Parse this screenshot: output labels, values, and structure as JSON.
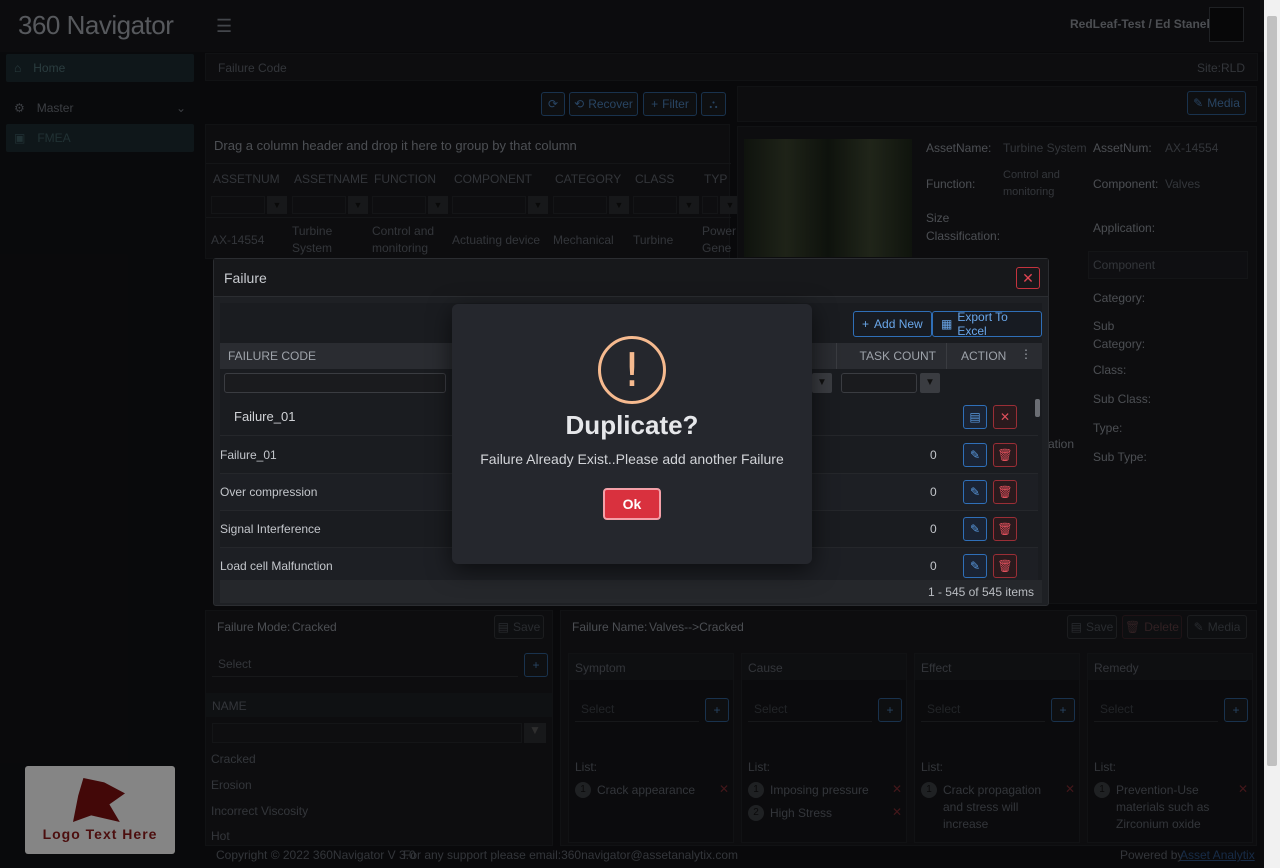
{
  "app": {
    "logo": "360 Navigator",
    "user": "RedLeaf-Test / Ed Stanek"
  },
  "sidebar": {
    "items": [
      {
        "label": "Home",
        "icon": "home-icon"
      },
      {
        "label": "Master",
        "icon": "gear-icon"
      },
      {
        "label": "FMEA",
        "icon": "layers-icon"
      }
    ],
    "logo_text": "Logo Text Here"
  },
  "breadcrumb": {
    "title": "Failure Code",
    "site": "Site:RLD"
  },
  "toolbar": {
    "recover": "Recover",
    "filter": "Filter"
  },
  "grid": {
    "group_hint": "Drag a column header and drop it here to group by that column",
    "columns": [
      "ASSETNUM",
      "ASSETNAME",
      "FUNCTION",
      "COMPONENT",
      "CATEGORY",
      "CLASS",
      "TYP"
    ],
    "row": [
      "AX-14554",
      "Turbine System",
      "Control and monitoring",
      "Actuating device",
      "Mechanical",
      "Turbine",
      "Power Gene"
    ]
  },
  "asset": {
    "media": "Media",
    "asset_name_label": "AssetName:",
    "asset_name": "Turbine System",
    "asset_num_label": "AssetNum:",
    "asset_num": "AX-14554",
    "function_label": "Function:",
    "function": "Control and monitoring",
    "component_label": "Component:",
    "component": "Valves",
    "size_label": "Size Classification:",
    "application_label": "Application:",
    "component_input": "Component",
    "category_label": "Category:",
    "subcategory_label": "Sub Category:",
    "class_label": "Class:",
    "subclass_label": "Sub Class:",
    "type_label": "Type:",
    "subtype_label": "Sub Type:",
    "tion_fragment": "ation"
  },
  "failure_mode": {
    "label": "Failure Mode:",
    "value": "Cracked",
    "save": "Save",
    "select": "Select",
    "name_header": "NAME",
    "names": [
      "Cracked",
      "Erosion",
      "Incorrect Viscosity",
      "Hot"
    ]
  },
  "failure_name": {
    "label": "Failure Name:",
    "value": "Valves-->Cracked",
    "save": "Save",
    "delete": "Delete",
    "media": "Media",
    "sections": [
      {
        "title": "Symptom",
        "select": "Select",
        "list_label": "List:",
        "items": [
          "Crack appearance"
        ]
      },
      {
        "title": "Cause",
        "select": "Select",
        "list_label": "List:",
        "items": [
          "Imposing pressure",
          "High Stress"
        ]
      },
      {
        "title": "Effect",
        "select": "Select",
        "list_label": "List:",
        "items": [
          "Crack propagation and stress will increase"
        ]
      },
      {
        "title": "Remedy",
        "select": "Select",
        "list_label": "List:",
        "items": [
          "Prevention-Use materials such as Zirconium oxide ceramics are good for"
        ]
      }
    ]
  },
  "footer": {
    "copyright": "Copyright © 2022 360Navigator V 3.0",
    "support": "For any support please email:360navigator@assetanalytix.com",
    "powered": "Powered by",
    "powered_link": "Asset Analytix"
  },
  "failure_modal": {
    "title": "Failure",
    "add_new": "Add New",
    "export": "Export To Excel",
    "col_code": "FAILURE CODE",
    "col_task": "TASK COUNT",
    "col_action": "ACTION",
    "edit_value": "Failure_01",
    "rows": [
      {
        "code": "Failure_01",
        "count": "0"
      },
      {
        "code": "Over compression",
        "count": "0"
      },
      {
        "code": "Signal Interference",
        "count": "0"
      },
      {
        "code": "Load cell Malfunction",
        "count": "0"
      }
    ],
    "pager": "1 - 545 of 545 items"
  },
  "dialog": {
    "icon": "!",
    "title": "Duplicate?",
    "message": "Failure Already Exist..Please add another Failure",
    "ok": "Ok"
  }
}
